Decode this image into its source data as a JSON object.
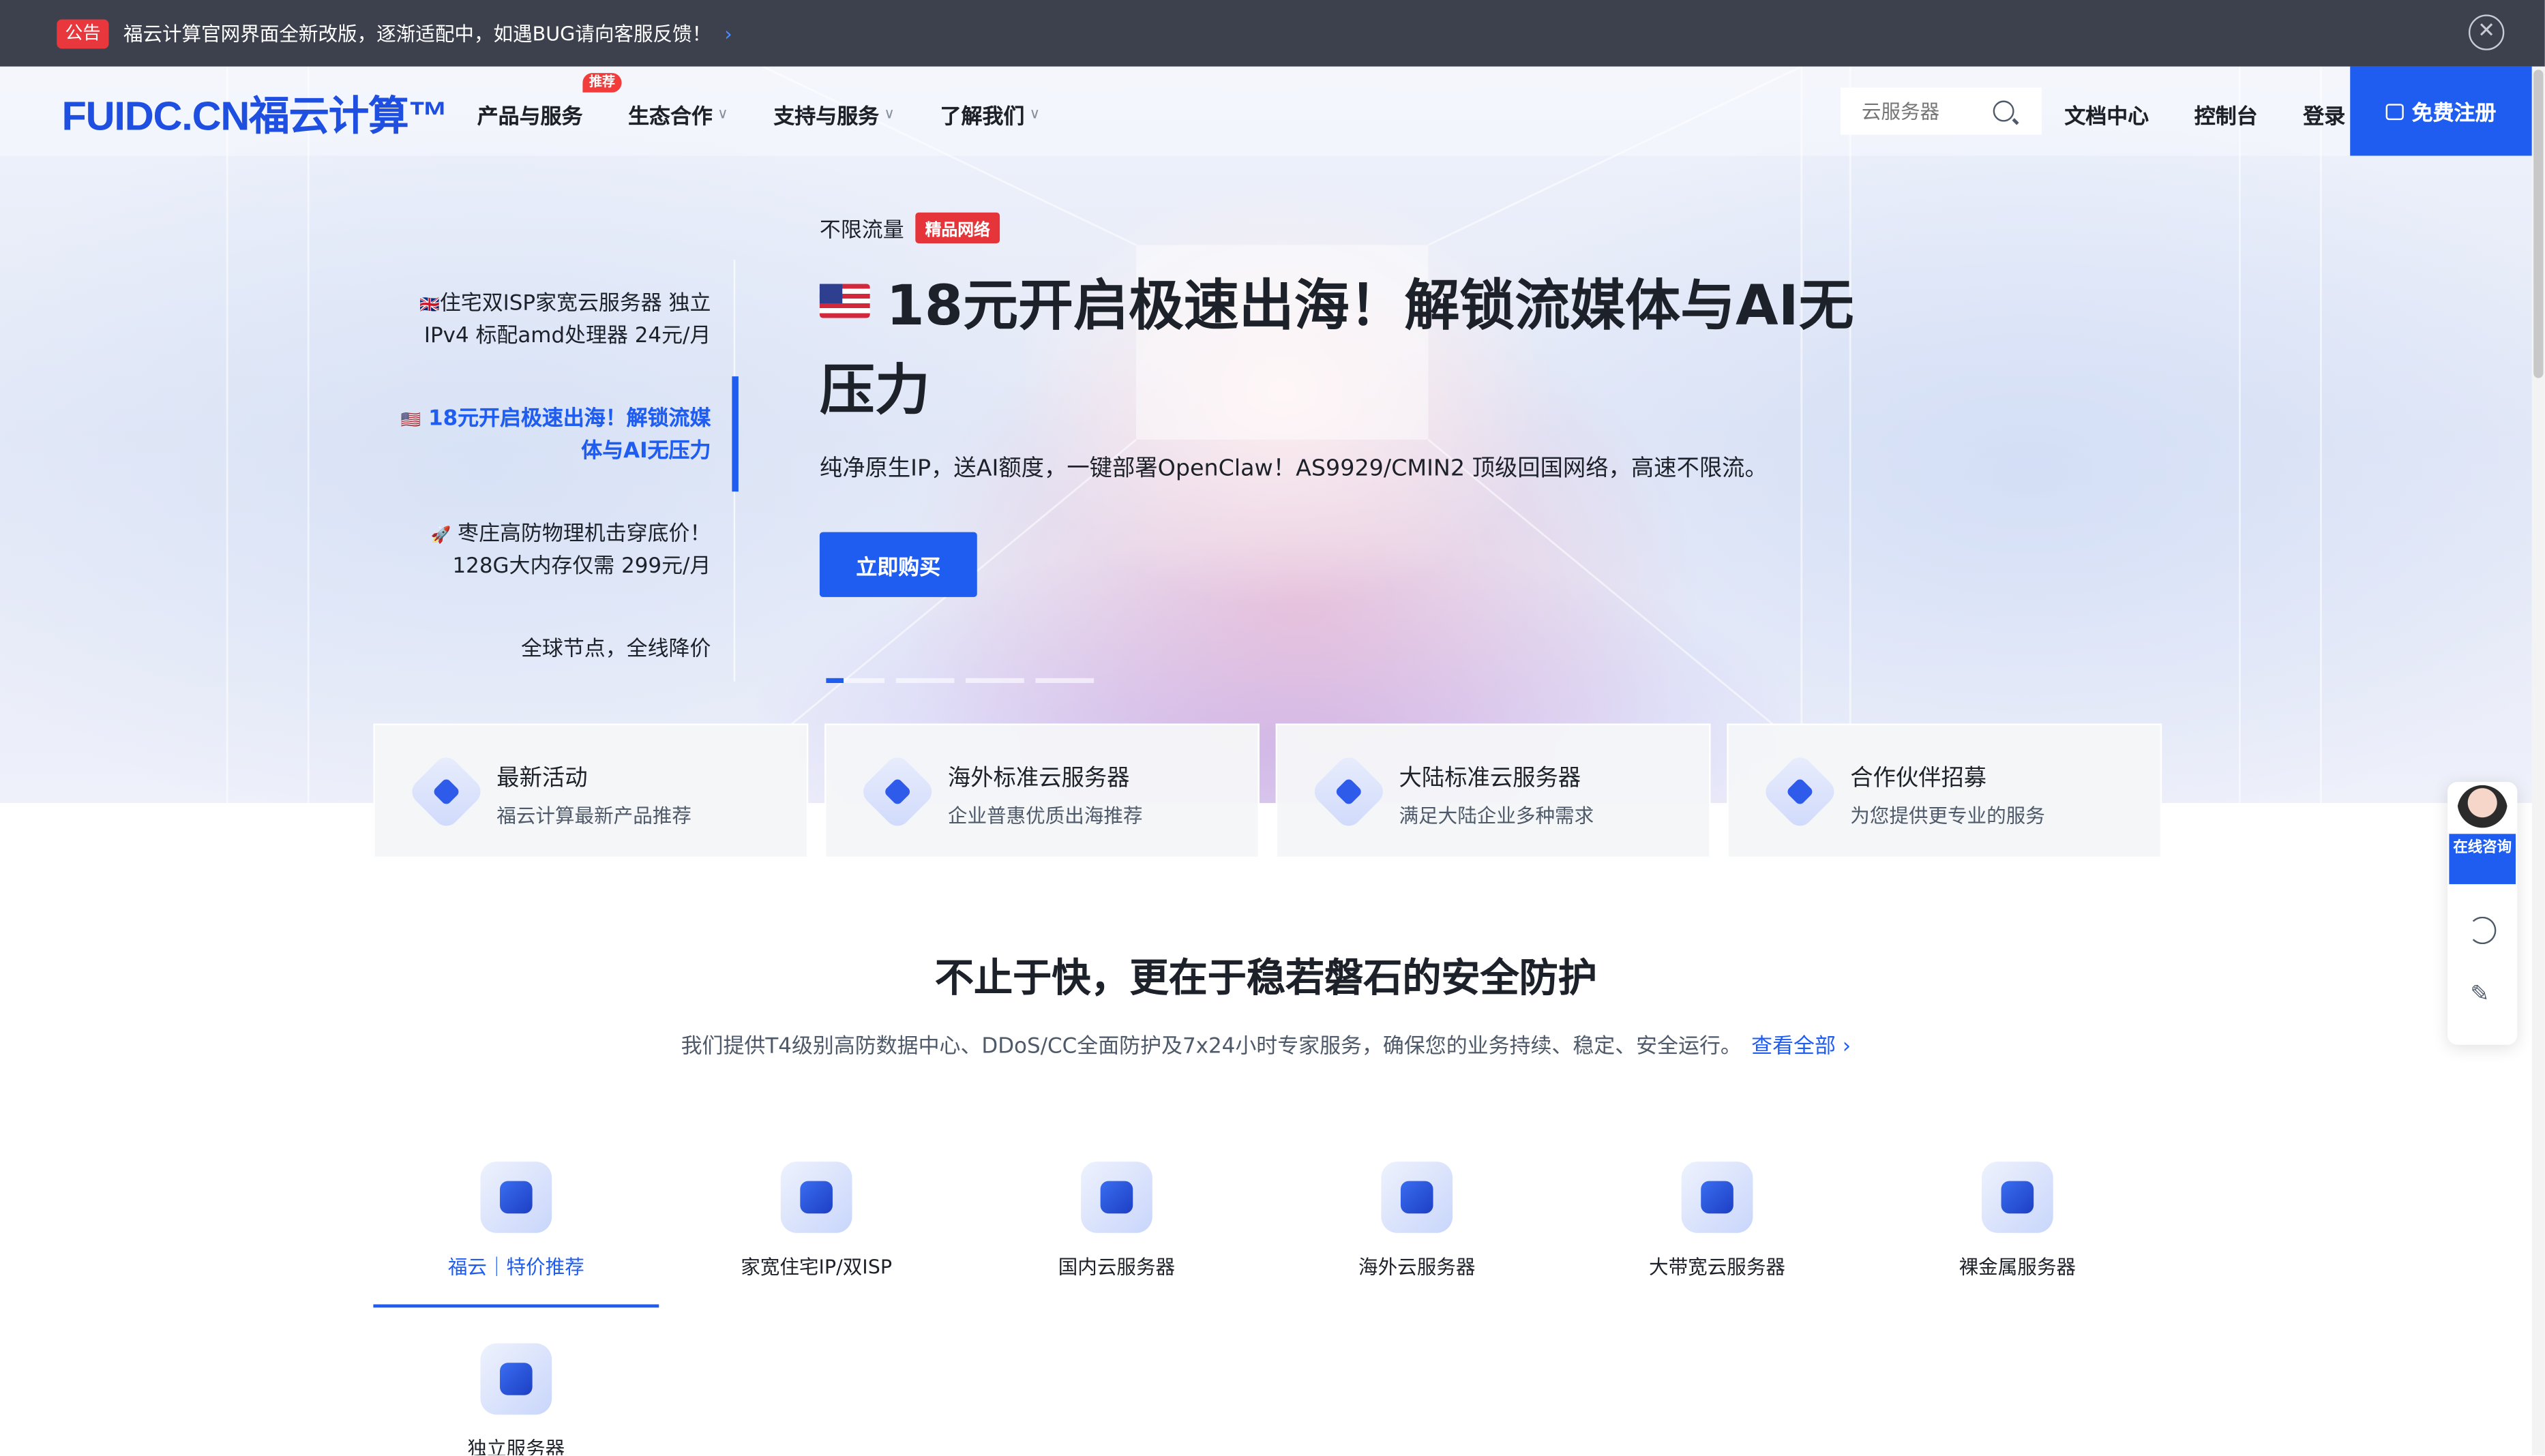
{
  "announcement": {
    "tag": "公告",
    "text": "福云计算官网界面全新改版，逐渐适配中，如遇BUG请向客服反馈！",
    "arrow": "›",
    "close": "✕"
  },
  "nav": {
    "logo": "FUIDC.CN福云计算™",
    "menu": [
      {
        "label": "产品与服务",
        "chev": ""
      },
      {
        "label": "生态合作",
        "chev": "∨",
        "badge": "推荐"
      },
      {
        "label": "支持与服务",
        "chev": "∨"
      },
      {
        "label": "了解我们",
        "chev": "∨"
      }
    ],
    "search_placeholder": "云服务器",
    "links": [
      "文档中心",
      "控制台",
      "登录"
    ],
    "register": "免费注册"
  },
  "slides": {
    "tabs": [
      {
        "flag": "🇬🇧",
        "label": "住宅双ISP家宽云服务器 独立IPv4 标配amd处理器 24元/月"
      },
      {
        "flag": "🇺🇸",
        "label": " 18元开启极速出海！解锁流媒体与AI无压力"
      },
      {
        "flag": "🚀",
        "label": " 枣庄高防物理机击穿底价！128G大内存仅需 299元/月"
      },
      {
        "flag": "",
        "label": "全球节点，全线降价"
      }
    ]
  },
  "hero": {
    "subtitle": "不限流量",
    "pill": "精品网络",
    "title": "18元开启极速出海！解锁流媒体与AI无压力",
    "desc": "纯净原生IP，送AI额度，一键部署OpenClaw！AS9929/CMIN2 顶级回国网络，高速不限流。",
    "cta": "立即购买"
  },
  "features": [
    {
      "title": "最新活动",
      "sub": "福云计算最新产品推荐"
    },
    {
      "title": "海外标准云服务器",
      "sub": "企业普惠优质出海推荐"
    },
    {
      "title": "大陆标准云服务器",
      "sub": "满足大陆企业多种需求"
    },
    {
      "title": "合作伙伴招募",
      "sub": "为您提供更专业的服务"
    }
  ],
  "section": {
    "title": "不止于快，更在于稳若磐石的安全防护",
    "desc": "我们提供T4级别高防数据中心、DDoS/CC全面防护及7x24小时专家服务，确保您的业务持续、稳定、安全运行。",
    "more": "查看全部 ›"
  },
  "categories": [
    "福云｜特价推荐",
    "家宽住宅IP/双ISP",
    "国内云服务器",
    "海外云服务器",
    "大带宽云服务器",
    "裸金属服务器",
    "独立服务器"
  ],
  "float": {
    "consult": "在线咨询"
  }
}
